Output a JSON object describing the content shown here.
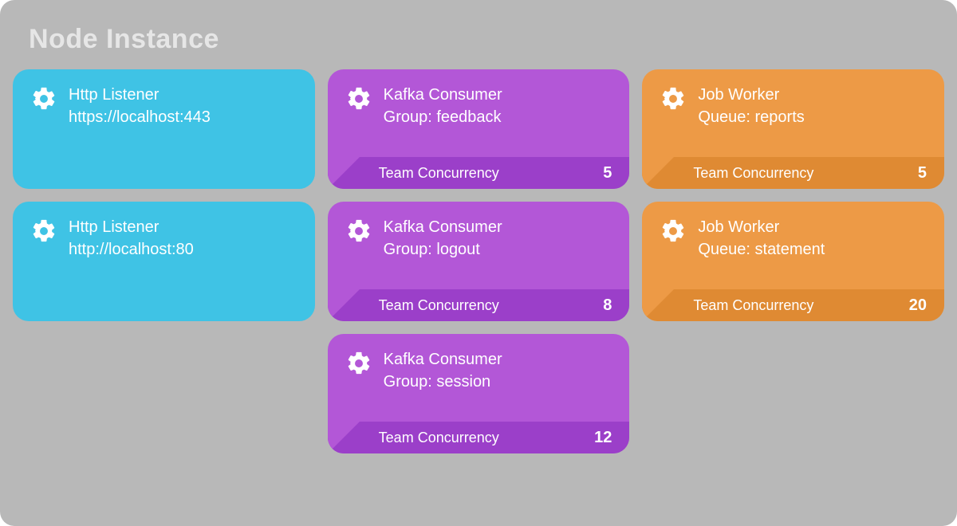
{
  "title": "Node Instance",
  "colors": {
    "cyan": "#3fc3e5",
    "purple": "#b357d7",
    "purple_dark": "#9b3fc9",
    "orange": "#ed9a46",
    "orange_dark": "#df8a33"
  },
  "footer_label": "Team Concurrency",
  "columns": [
    {
      "color": "cyan",
      "cards": [
        {
          "icon": "gear-icon",
          "line1": "Http Listener",
          "line2": "https://localhost:443"
        },
        {
          "icon": "gear-icon",
          "line1": "Http Listener",
          "line2": "http://localhost:80"
        }
      ]
    },
    {
      "color": "purple",
      "cards": [
        {
          "icon": "gear-icon",
          "line1": "Kafka Consumer",
          "line2": "Group: feedback",
          "concurrency": 5
        },
        {
          "icon": "gear-icon",
          "line1": "Kafka Consumer",
          "line2": "Group: logout",
          "concurrency": 8
        },
        {
          "icon": "gear-icon",
          "line1": "Kafka Consumer",
          "line2": "Group: session",
          "concurrency": 12
        }
      ]
    },
    {
      "color": "orange",
      "cards": [
        {
          "icon": "gear-icon",
          "line1": "Job Worker",
          "line2": "Queue: reports",
          "concurrency": 5
        },
        {
          "icon": "gear-icon",
          "line1": "Job Worker",
          "line2": "Queue: statement",
          "concurrency": 20
        }
      ]
    }
  ]
}
